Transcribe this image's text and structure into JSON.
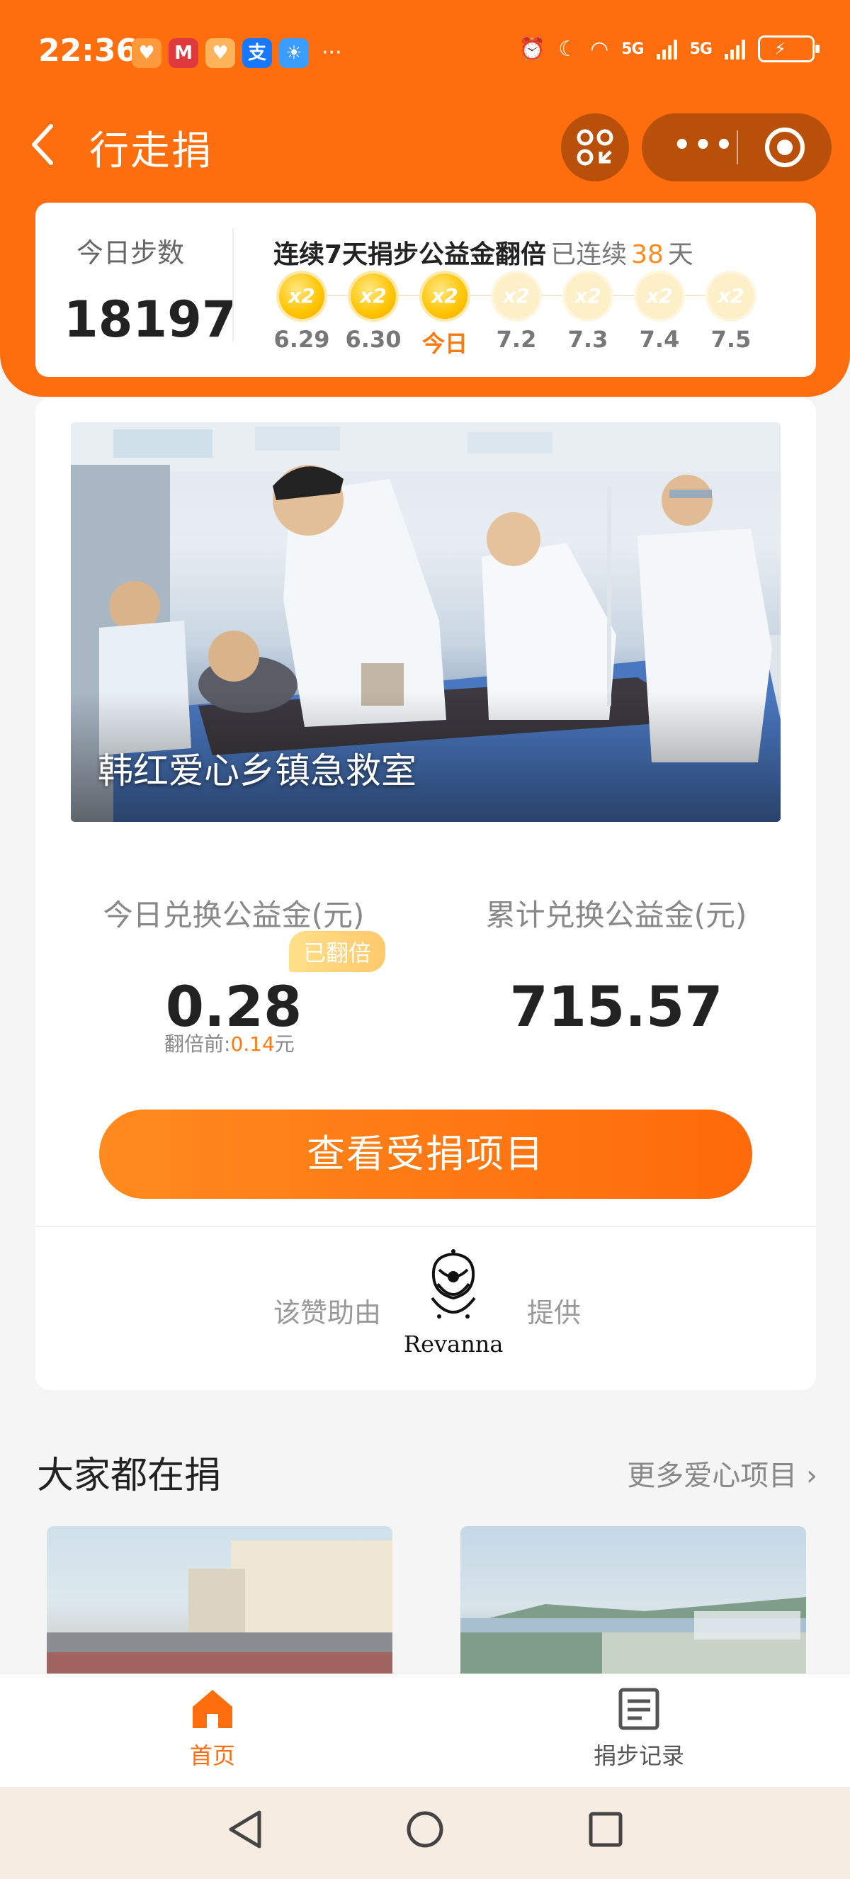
{
  "status_bar": {
    "time": "22:36",
    "signal1": "5G",
    "signal2": "5G"
  },
  "header": {
    "title": "行走捐",
    "menu_dots": "•••"
  },
  "steps": {
    "today_label": "今日步数",
    "today_value": "18197",
    "streak_text": "连续7天捐步公益金翻倍",
    "streak_prefix": "已连续",
    "streak_count": "38",
    "streak_unit": "天",
    "days": [
      {
        "label": "6.29",
        "badge": "x2",
        "active": true
      },
      {
        "label": "6.30",
        "badge": "x2",
        "active": true
      },
      {
        "label": "今日",
        "badge": "x2",
        "active": true
      },
      {
        "label": "7.2",
        "badge": "x2",
        "active": false
      },
      {
        "label": "7.3",
        "badge": "x2",
        "active": false
      },
      {
        "label": "7.4",
        "badge": "x2",
        "active": false
      },
      {
        "label": "7.5",
        "badge": "x2",
        "active": false
      }
    ]
  },
  "project": {
    "title": "韩红爱心乡镇急救室"
  },
  "stats": {
    "today_label": "今日兑换公益金(元)",
    "today_value": "0.28",
    "doubled_badge": "已翻倍",
    "before_prefix": "翻倍前:",
    "before_value": "0.14",
    "before_unit": "元",
    "total_label": "累计兑换公益金(元)",
    "total_value": "715.57"
  },
  "cta": {
    "label": "查看受捐项目"
  },
  "sponsor": {
    "prefix": "该赞助由",
    "suffix": "提供",
    "brand": "Revanna"
  },
  "section": {
    "title": "大家都在捐",
    "more": "更多爱心项目"
  },
  "tabbar": {
    "home": "首页",
    "records": "捐步记录"
  },
  "colors": {
    "brand_orange": "#ff6e0e",
    "accent_gold": "#ffc400",
    "highlight": "#ff7a10"
  }
}
